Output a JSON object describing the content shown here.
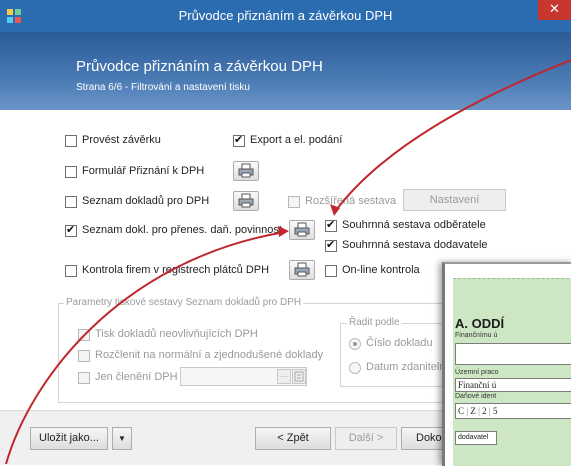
{
  "window": {
    "title": "Průvodce přiznáním a závěrkou DPH",
    "close_glyph": "✕"
  },
  "header": {
    "title": "Průvodce přiznáním a závěrkou DPH",
    "subtitle": "Strana 6/6 - Filtrování a nastavení tisku"
  },
  "options": {
    "provest_zaverku": {
      "label": "Provést závěrku",
      "checked": false
    },
    "export": {
      "label": "Export a el. podání",
      "checked": true
    },
    "formular": {
      "label": "Formulář Přiznání k DPH",
      "checked": false
    },
    "seznam_dokladu": {
      "label": "Seznam dokladů pro DPH",
      "checked": false
    },
    "rozsirena": {
      "label": "Rozšířená sestava",
      "checked": false,
      "enabled": false
    },
    "nastaveni_button": "Nastavení",
    "seznam_prenes": {
      "label": "Seznam dokl. pro přenes. daň. povinnost",
      "checked": true
    },
    "souhrnna_odberatele": {
      "label": "Souhrnná sestava odběratele",
      "checked": true
    },
    "souhrnna_dodavatele": {
      "label": "Souhrnná sestava dodavatele",
      "checked": true
    },
    "kontrola_firem": {
      "label": "Kontrola firem v registrech plátců DPH",
      "checked": false
    },
    "online_kontrola": {
      "label": "On-line kontrola",
      "checked": false
    }
  },
  "params_group": {
    "legend": "Parametry tiskové sestavy Seznam dokladů pro DPH",
    "tisk_neovl": "Tisk dokladů neovlivňujících DPH",
    "rozclenit": "Rozčlenit na normální a zjednodušené doklady",
    "jen_cleneni": "Jen členění DPH",
    "radit_legend": "Řadit podle",
    "radit_options": [
      {
        "label": "Číslo dokladu",
        "selected": true
      },
      {
        "label": "Datum zdanitelné",
        "selected": false
      }
    ]
  },
  "footer": {
    "save_as": "Uložit jako...",
    "back": "< Zpět",
    "next": "Další >",
    "finish": "Dokon"
  },
  "preview": {
    "heading": "A. ODDÍ",
    "label1": "Finančnímu ú",
    "label2": "Územní praco",
    "field2": "Finanční ú",
    "label3": "Daňové ident",
    "dic": [
      "C",
      "Z",
      "2",
      "5"
    ],
    "footer_cell": "dodavatel"
  },
  "colors": {
    "titlebar": "#2b6cb1",
    "close": "#c7372f",
    "arrow": "#c0272d",
    "preview_green": "#cde7c4"
  }
}
